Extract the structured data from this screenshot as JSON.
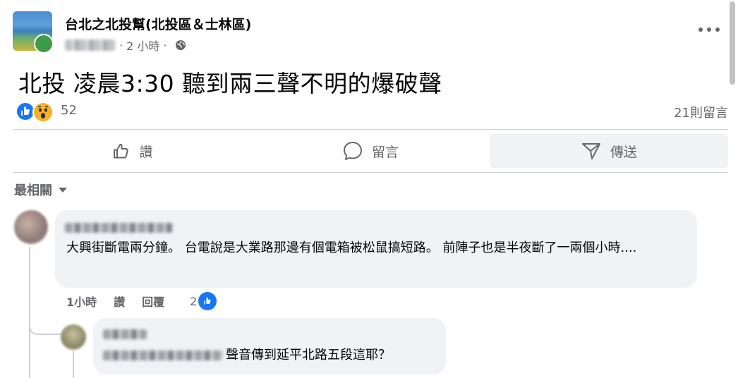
{
  "post": {
    "group_name": "台北之北投幫(北投區＆士林區)",
    "time": "2 小時",
    "separator": "·",
    "text": "北投 凌晨3:30 聽到兩三聲不明的爆破聲",
    "reaction_count": "52",
    "comment_count": "21則留言"
  },
  "actions": {
    "like": "讚",
    "comment": "留言",
    "share": "傳送"
  },
  "comments_section": {
    "sort_label": "最相關",
    "comments": [
      {
        "text": "大興街斷電兩分鐘。 台電說是大業路那邊有個電箱被松鼠搞短路。 前陣子也是半夜斷了一兩個小時....",
        "time": "1小時",
        "like_label": "讚",
        "reply_label": "回覆",
        "like_count": "2"
      }
    ],
    "reply": {
      "text": "聲音傳到延平北路五段這耶？"
    }
  },
  "icons": {
    "more": "more-horizontal-icon",
    "globe": "globe-icon",
    "like": "thumbs-up-icon",
    "comment": "comment-bubble-icon",
    "share": "send-icon",
    "sort": "caret-down-icon"
  },
  "colors": {
    "facebook_blue": "#1877f2",
    "muted_text": "#65676b",
    "bubble_bg": "#f0f2f5"
  }
}
